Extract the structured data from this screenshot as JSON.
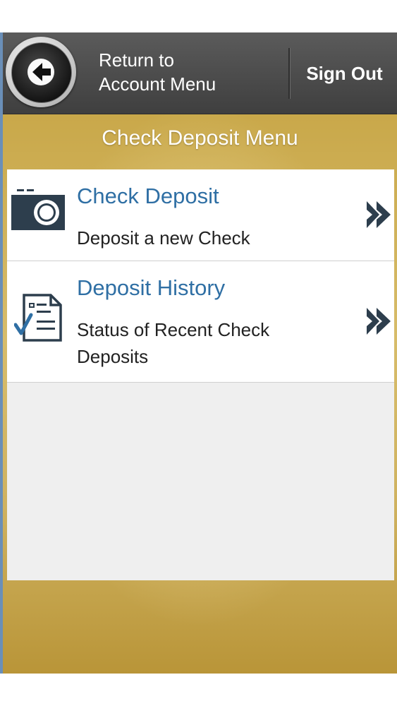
{
  "header": {
    "back_label_line1": "Return to",
    "back_label_line2": "Account Menu",
    "signout_label": "Sign Out"
  },
  "page": {
    "title": "Check Deposit Menu"
  },
  "menu": {
    "items": [
      {
        "title": "Check Deposit",
        "description": "Deposit a new Check",
        "icon": "camera-icon"
      },
      {
        "title": "Deposit History",
        "description": "Status of Recent Check Deposits",
        "icon": "document-check-icon"
      }
    ]
  },
  "colors": {
    "header_bg": "#4a4a4a",
    "gold_bg": "#d2b563",
    "item_title": "#2f6fa4",
    "icon_dark": "#2d3e4d"
  }
}
